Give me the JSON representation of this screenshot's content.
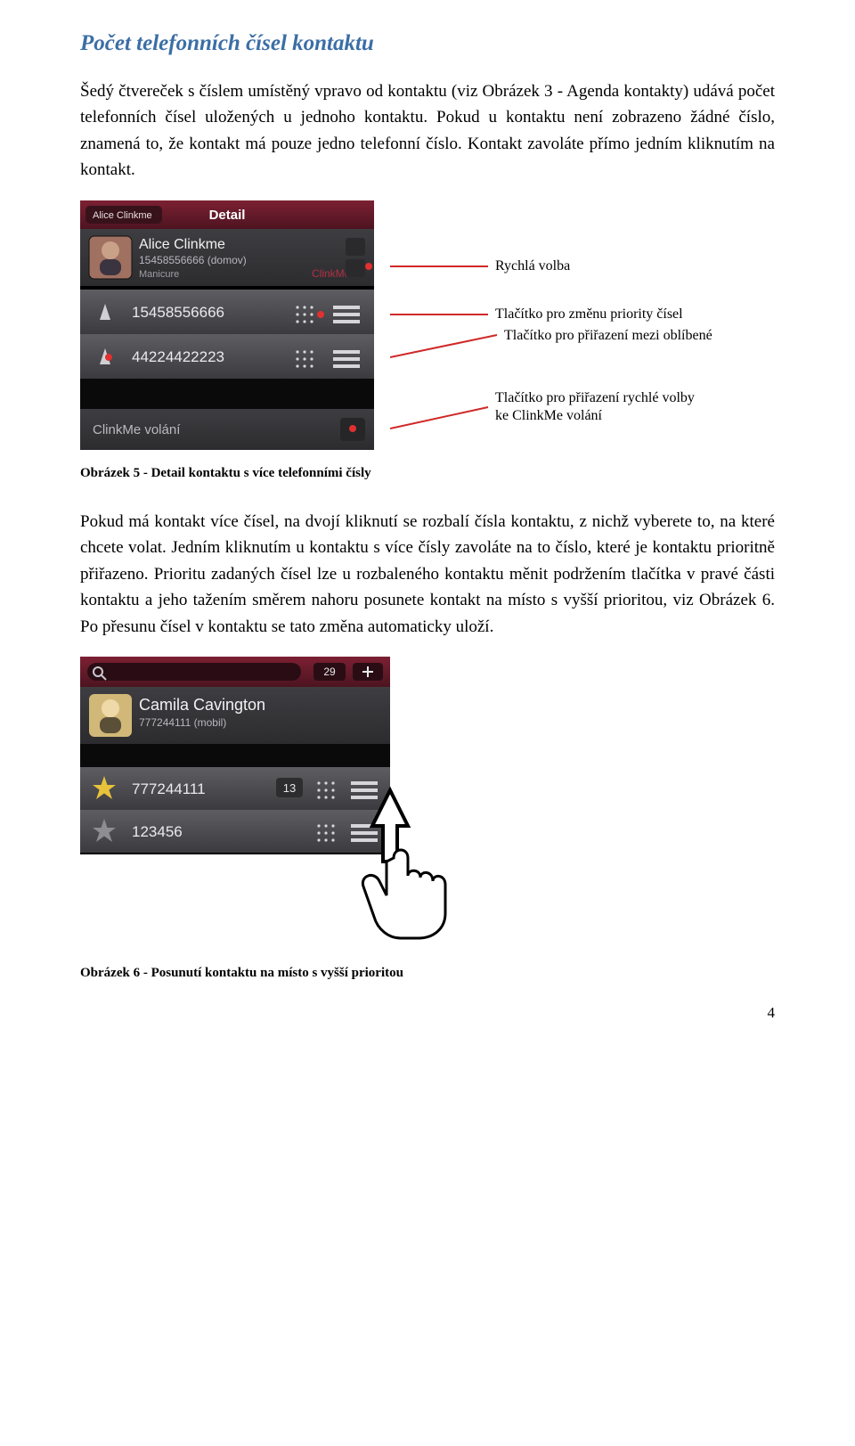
{
  "title": "Počet telefonních čísel kontaktu",
  "para1": "Šedý čtvereček s číslem umístěný vpravo od kontaktu (viz Obrázek 3 - Agenda kontakty) udává počet telefonních čísel uložených u jednoho kontaktu. Pokud u kontaktu není zobrazeno žádné číslo, znamená to, že kontakt má pouze jedno telefonní číslo. Kontakt zavoláte přímo jedním kliknutím na kontakt.",
  "para2": "Pokud má kontakt více čísel, na dvojí kliknutí se rozbalí čísla kontaktu, z nichž vyberete to, na které chcete volat. Jedním kliknutím u kontaktu s více čísly zavoláte na to číslo, které je kontaktu prioritně přiřazeno. Prioritu zadaných čísel lze u rozbaleného kontaktu měnit podržením tlačítka v pravé části kontaktu a jeho tažením směrem nahoru posunete kontakt na místo s vyšší prioritou, viz Obrázek 6. Po přesunu čísel v kontaktu se tato změna automaticky uloží.",
  "caption5": "Obrázek 5 - Detail kontaktu s více telefonními čísly",
  "caption6": "Obrázek 6 - Posunutí kontaktu na místo s vyšší prioritou",
  "annots": {
    "a1": "Rychlá volba",
    "a2": "Tlačítko pro změnu priority čísel",
    "a3": "Tlačítko pro přiřazení mezi oblíbené",
    "a4a": "Tlačítko pro přiřazení rychlé volby",
    "a4b": "ke ClinkMe volání"
  },
  "shotA": {
    "navBack": "Alice Clinkme",
    "navTitle": "Detail",
    "name": "Alice Clinkme",
    "sub": "15458556666 (domov)",
    "tag": "Manicure",
    "brand": "ClinkMe",
    "num1": "15458556666",
    "num2": "44224422223",
    "footer": "ClinkMe volání"
  },
  "shotB": {
    "badge": "29",
    "name": "Camila Cavington",
    "sub": "777244111 (mobil)",
    "num1": "777244111",
    "num1b": "13",
    "num2": "123456"
  },
  "pageNumber": "4"
}
